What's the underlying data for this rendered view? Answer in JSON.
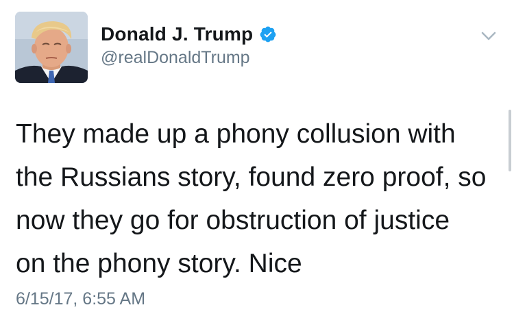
{
  "tweet": {
    "display_name": "Donald J. Trump",
    "handle": "@realDonaldTrump",
    "verified": true,
    "text": "They made up a phony collusion with\nthe Russians story, found zero proof, so\nnow they go for obstruction of justice\non the phony story. Nice",
    "timestamp": "6/15/17, 6:55 AM"
  },
  "icons": {
    "verified": "verified-badge-icon",
    "menu": "chevron-down-icon",
    "avatar": "profile-photo"
  },
  "colors": {
    "verified_blue": "#1da1f2",
    "secondary_text": "#657786",
    "primary_text": "#14171a",
    "chevron": "#aab8c2"
  }
}
